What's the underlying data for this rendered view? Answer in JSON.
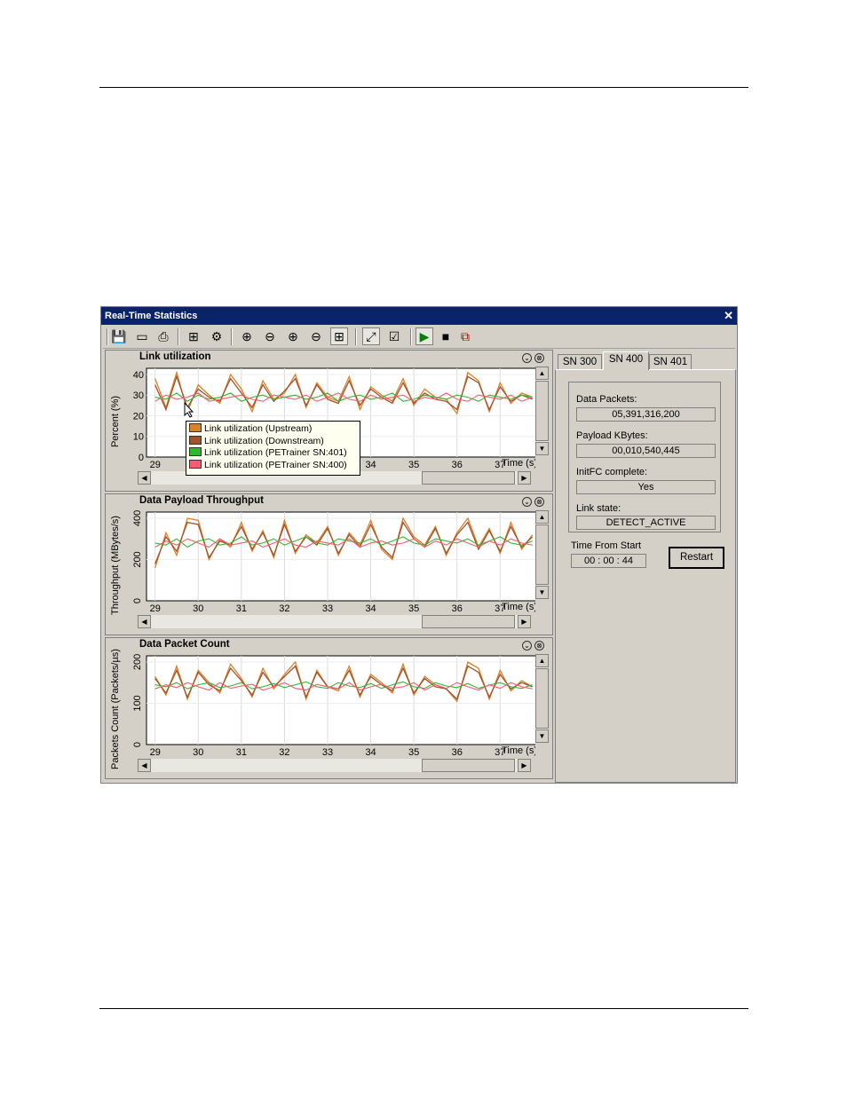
{
  "window": {
    "title": "Real-Time Statistics",
    "close_glyph": "✕"
  },
  "toolbar": [
    {
      "name": "save-icon",
      "glyph": "💾"
    },
    {
      "name": "open-icon",
      "glyph": "▭"
    },
    {
      "name": "print-icon",
      "glyph": "⎙"
    },
    {
      "name": "grid-icon",
      "glyph": "⊞"
    },
    {
      "name": "settings-icon",
      "glyph": "⚙"
    },
    {
      "name": "zoom-in-x-icon",
      "glyph": "⊕"
    },
    {
      "name": "zoom-out-x-icon",
      "glyph": "⊖"
    },
    {
      "name": "zoom-in-y-icon",
      "glyph": "⊕"
    },
    {
      "name": "zoom-out-y-icon",
      "glyph": "⊖"
    },
    {
      "name": "zoom-box-icon",
      "glyph": "⊞"
    },
    {
      "name": "auto-scale-icon",
      "glyph": "⤢"
    },
    {
      "name": "chart-select-icon",
      "glyph": "☑"
    },
    {
      "name": "play-icon",
      "glyph": "▶"
    },
    {
      "name": "stop-icon",
      "glyph": "■"
    },
    {
      "name": "detach-icon",
      "glyph": "⧉"
    }
  ],
  "colors": {
    "upstream": "#d9822b",
    "downstream": "#a0522d",
    "sn401": "#2fb82f",
    "sn400": "#ff5a6e",
    "titlebar": "#0a246a"
  },
  "panels": [
    {
      "title": "Link utilization",
      "ylabel": "Percent (%)",
      "xlabel": "Time (s)",
      "yticks": [
        "40",
        "30",
        "20",
        "10",
        "0"
      ],
      "xticks": [
        "29",
        "30",
        "31",
        "32",
        "33",
        "34",
        "35",
        "36",
        "37"
      ],
      "collapse_glyph": "⌄",
      "close_glyph": "⊗"
    },
    {
      "title": "Data Payload Throughput",
      "ylabel": "Throughput (MBytes/s)",
      "xlabel": "Time (s)",
      "yticks": [
        "400",
        "200",
        "0"
      ],
      "xticks": [
        "29",
        "30",
        "31",
        "32",
        "33",
        "34",
        "35",
        "36",
        "37"
      ],
      "collapse_glyph": "⌄",
      "close_glyph": "⊗"
    },
    {
      "title": "Data Packet Count",
      "ylabel": "Packets Count (Packets/µs)",
      "xlabel": "Time (s)",
      "yticks": [
        "200",
        "100",
        "0"
      ],
      "xticks": [
        "29",
        "30",
        "31",
        "32",
        "33",
        "34",
        "35",
        "36",
        "37"
      ],
      "collapse_glyph": "⌄",
      "close_glyph": "⊗"
    }
  ],
  "legend": [
    "Link utilization (Upstream)",
    "Link utilization (Downstream)",
    "Link utilization (PETrainer SN:401)",
    "Link utilization (PETrainer SN:400)"
  ],
  "chart_data": [
    {
      "type": "line",
      "title": "Link utilization",
      "xlabel": "Time (s)",
      "ylabel": "Percent (%)",
      "xlim": [
        28.8,
        37.9
      ],
      "ylim": [
        0,
        43
      ],
      "x": [
        29,
        29.25,
        29.5,
        29.75,
        30,
        30.25,
        30.5,
        30.75,
        31,
        31.25,
        31.5,
        31.75,
        32,
        32.25,
        32.5,
        32.75,
        33,
        33.25,
        33.5,
        33.75,
        34,
        34.25,
        34.5,
        34.75,
        35,
        35.25,
        35.5,
        35.75,
        36,
        36.25,
        36.5,
        36.75,
        37,
        37.25,
        37.5,
        37.75
      ],
      "series": [
        {
          "name": "Link utilization (Upstream)",
          "values": [
            38,
            24,
            41,
            22,
            35,
            30,
            26,
            40,
            33,
            22,
            37,
            28,
            31,
            40,
            24,
            36,
            29,
            27,
            39,
            23,
            34,
            30,
            27,
            38,
            25,
            33,
            29,
            28,
            21,
            41,
            37,
            22,
            36,
            26,
            31,
            29
          ]
        },
        {
          "name": "Link utilization (Downstream)",
          "values": [
            35,
            23,
            39,
            24,
            33,
            29,
            27,
            38,
            31,
            24,
            35,
            27,
            32,
            38,
            25,
            35,
            28,
            26,
            37,
            25,
            33,
            29,
            26,
            36,
            26,
            31,
            28,
            27,
            23,
            39,
            36,
            23,
            34,
            27,
            30,
            28
          ]
        },
        {
          "name": "Link utilization (PETrainer SN:401)",
          "values": [
            29,
            28,
            31,
            27,
            30,
            28,
            29,
            31,
            27,
            29,
            30,
            28,
            29,
            30,
            28,
            29,
            31,
            27,
            29,
            30,
            28,
            29,
            31,
            27,
            28,
            30,
            29,
            28,
            30,
            29,
            27,
            30,
            29,
            28,
            30,
            29
          ]
        },
        {
          "name": "Link utilization (PETrainer SN:400)",
          "values": [
            27,
            30,
            28,
            29,
            31,
            27,
            28,
            29,
            30,
            28,
            27,
            30,
            29,
            28,
            30,
            27,
            29,
            31,
            28,
            27,
            30,
            28,
            29,
            30,
            27,
            29,
            28,
            31,
            28,
            27,
            30,
            29,
            28,
            30,
            27,
            29
          ]
        }
      ]
    },
    {
      "type": "line",
      "title": "Data Payload Throughput",
      "xlabel": "Time (s)",
      "ylabel": "Throughput (MBytes/s)",
      "xlim": [
        28.8,
        37.9
      ],
      "ylim": [
        0,
        430
      ],
      "x": [
        29,
        29.25,
        29.5,
        29.75,
        30,
        30.25,
        30.5,
        30.75,
        31,
        31.25,
        31.5,
        31.75,
        32,
        32.25,
        32.5,
        32.75,
        33,
        33.25,
        33.5,
        33.75,
        34,
        34.25,
        34.5,
        34.75,
        35,
        35.25,
        35.5,
        35.75,
        36,
        36.25,
        36.5,
        36.75,
        37,
        37.25,
        37.5,
        37.75
      ],
      "series": [
        {
          "name": "Link utilization (Upstream)",
          "values": [
            160,
            330,
            220,
            400,
            390,
            200,
            300,
            260,
            380,
            240,
            340,
            210,
            390,
            230,
            320,
            280,
            360,
            220,
            330,
            270,
            390,
            250,
            200,
            400,
            310,
            270,
            360,
            220,
            330,
            400,
            260,
            350,
            230,
            380,
            250,
            320
          ]
        },
        {
          "name": "Link utilization (Downstream)",
          "values": [
            180,
            310,
            240,
            380,
            370,
            210,
            290,
            270,
            360,
            250,
            330,
            220,
            370,
            240,
            310,
            270,
            350,
            230,
            320,
            260,
            370,
            260,
            210,
            380,
            300,
            260,
            350,
            230,
            320,
            380,
            250,
            340,
            240,
            360,
            260,
            310
          ]
        },
        {
          "name": "Link utilization (PETrainer SN:401)",
          "values": [
            280,
            270,
            300,
            260,
            290,
            300,
            270,
            280,
            310,
            270,
            280,
            300,
            270,
            290,
            310,
            280,
            270,
            300,
            290,
            280,
            300,
            270,
            290,
            310,
            280,
            270,
            300,
            290,
            280,
            300,
            270,
            290,
            310,
            280,
            270,
            290
          ]
        },
        {
          "name": "Link utilization (PETrainer SN:400)",
          "values": [
            260,
            290,
            270,
            300,
            280,
            260,
            300,
            270,
            280,
            290,
            260,
            280,
            300,
            270,
            260,
            290,
            280,
            270,
            300,
            260,
            280,
            290,
            270,
            280,
            300,
            260,
            290,
            270,
            300,
            280,
            260,
            290,
            270,
            300,
            280,
            270
          ]
        }
      ]
    },
    {
      "type": "line",
      "title": "Data Packet Count",
      "xlabel": "Time (s)",
      "ylabel": "Packets Count (Packets/µs)",
      "xlim": [
        28.8,
        37.9
      ],
      "ylim": [
        0,
        215
      ],
      "x": [
        29,
        29.25,
        29.5,
        29.75,
        30,
        30.25,
        30.5,
        30.75,
        31,
        31.25,
        31.5,
        31.75,
        32,
        32.25,
        32.5,
        32.75,
        33,
        33.25,
        33.5,
        33.75,
        34,
        34.25,
        34.5,
        34.75,
        35,
        35.25,
        35.5,
        35.75,
        36,
        36.25,
        36.5,
        36.75,
        37,
        37.25,
        37.5,
        37.75
      ],
      "series": [
        {
          "name": "Link utilization (Upstream)",
          "values": [
            165,
            120,
            190,
            110,
            180,
            150,
            125,
            195,
            160,
            115,
            185,
            135,
            170,
            200,
            110,
            180,
            140,
            130,
            190,
            115,
            170,
            150,
            125,
            195,
            120,
            165,
            145,
            135,
            105,
            200,
            185,
            110,
            180,
            130,
            155,
            140
          ]
        },
        {
          "name": "Link utilization (Downstream)",
          "values": [
            160,
            125,
            180,
            115,
            175,
            145,
            130,
            185,
            155,
            120,
            175,
            140,
            165,
            190,
            115,
            175,
            140,
            135,
            180,
            120,
            165,
            145,
            130,
            185,
            125,
            160,
            140,
            135,
            110,
            190,
            175,
            115,
            170,
            135,
            150,
            140
          ]
        },
        {
          "name": "Link utilization (PETrainer SN:401)",
          "values": [
            145,
            140,
            150,
            135,
            145,
            150,
            138,
            142,
            150,
            135,
            140,
            148,
            138,
            145,
            152,
            140,
            136,
            150,
            142,
            138,
            148,
            136,
            145,
            152,
            140,
            136,
            150,
            142,
            138,
            148,
            136,
            144,
            150,
            140,
            136,
            145
          ]
        },
        {
          "name": "Link utilization (PETrainer SN:400)",
          "values": [
            135,
            145,
            138,
            150,
            140,
            132,
            150,
            136,
            142,
            146,
            132,
            140,
            150,
            136,
            132,
            146,
            140,
            135,
            150,
            132,
            140,
            146,
            136,
            140,
            150,
            132,
            145,
            136,
            150,
            140,
            132,
            145,
            136,
            150,
            140,
            135
          ]
        }
      ]
    }
  ],
  "tabs": [
    "SN 300",
    "SN 400",
    "SN 401"
  ],
  "active_tab": "SN 400",
  "stats": {
    "data_packets_label": "Data Packets:",
    "data_packets_value": "05,391,316,200",
    "payload_label": "Payload KBytes:",
    "payload_value": "00,010,540,445",
    "initfc_label": "InitFC complete:",
    "initfc_value": "Yes",
    "link_state_label": "Link state:",
    "link_state_value": "DETECT_ACTIVE"
  },
  "timer": {
    "label": "Time From Start",
    "value": "00 : 00 : 44"
  },
  "restart_label": "Restart"
}
